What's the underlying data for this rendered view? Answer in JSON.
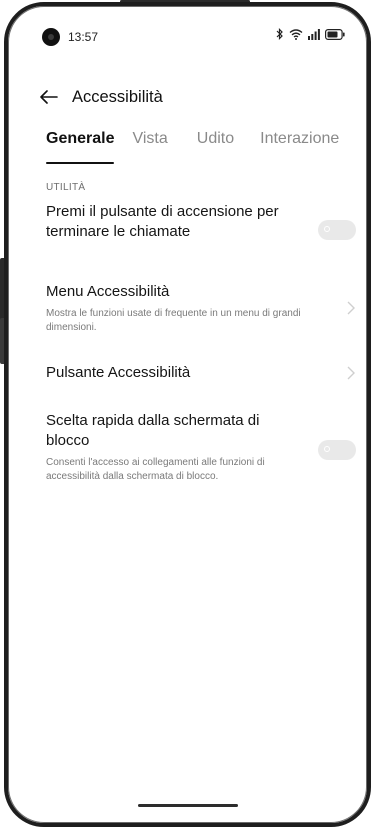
{
  "status_bar": {
    "time": "13:57",
    "icons": [
      "bluetooth-icon",
      "wifi-icon",
      "signal-icon",
      "battery-icon"
    ]
  },
  "header": {
    "title": "Accessibilità",
    "back_icon": "arrow-left-icon"
  },
  "tabs": [
    {
      "label": "Generale",
      "active": true
    },
    {
      "label": "Vista",
      "active": false
    },
    {
      "label": "Udito",
      "active": false
    },
    {
      "label": "Interazione",
      "active": false
    }
  ],
  "section": {
    "label": "UTILITÀ"
  },
  "items": [
    {
      "title": "Premi il pulsante di accensione per terminare le chiamate",
      "control": "toggle",
      "on": false
    },
    {
      "title": "Menu Accessibilità",
      "desc": "Mostra le funzioni usate di frequente in un menu di grandi dimensioni.",
      "control": "chevron"
    },
    {
      "title": "Pulsante Accessibilità",
      "control": "chevron"
    },
    {
      "title": "Scelta rapida dalla schermata di blocco",
      "desc": "Consenti l'accesso ai collegamenti alle funzioni di accessibilità dalla schermata di blocco.",
      "control": "toggle",
      "on": false
    }
  ],
  "colors": {
    "text": "#151515",
    "muted": "#7a7a7a",
    "toggle_off": "#e9e9e9"
  }
}
